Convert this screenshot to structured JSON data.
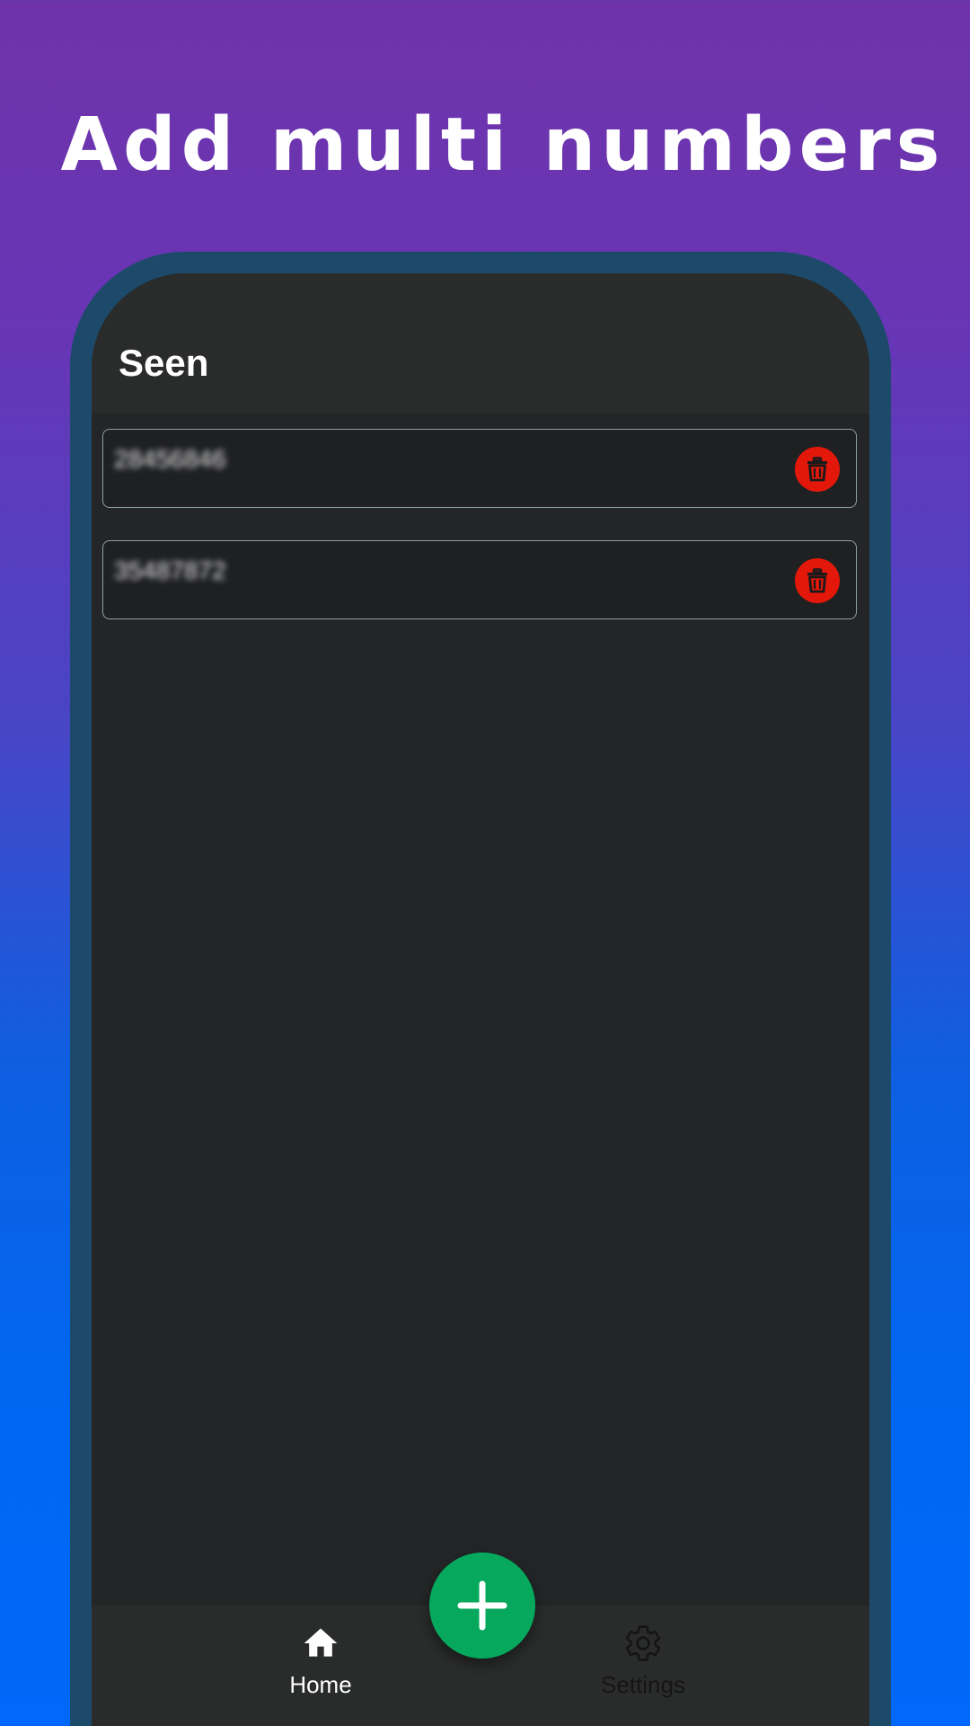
{
  "promo": {
    "headline": "Add multi numbers"
  },
  "app": {
    "title": "Seen"
  },
  "numbers": [
    {
      "value": "28456846",
      "delete_icon": "trash-icon"
    },
    {
      "value": "35487872",
      "delete_icon": "trash-icon"
    }
  ],
  "fab": {
    "icon": "plus-icon"
  },
  "bottom_nav": {
    "items": [
      {
        "label": "Home",
        "icon": "home-icon",
        "active": true
      },
      {
        "label": "Settings",
        "icon": "gear-icon",
        "active": false
      }
    ]
  },
  "colors": {
    "accent_green": "#05a85d",
    "delete_red": "#e3170a",
    "frame_blue": "#1d4a6a",
    "screen_bg": "#242527"
  }
}
